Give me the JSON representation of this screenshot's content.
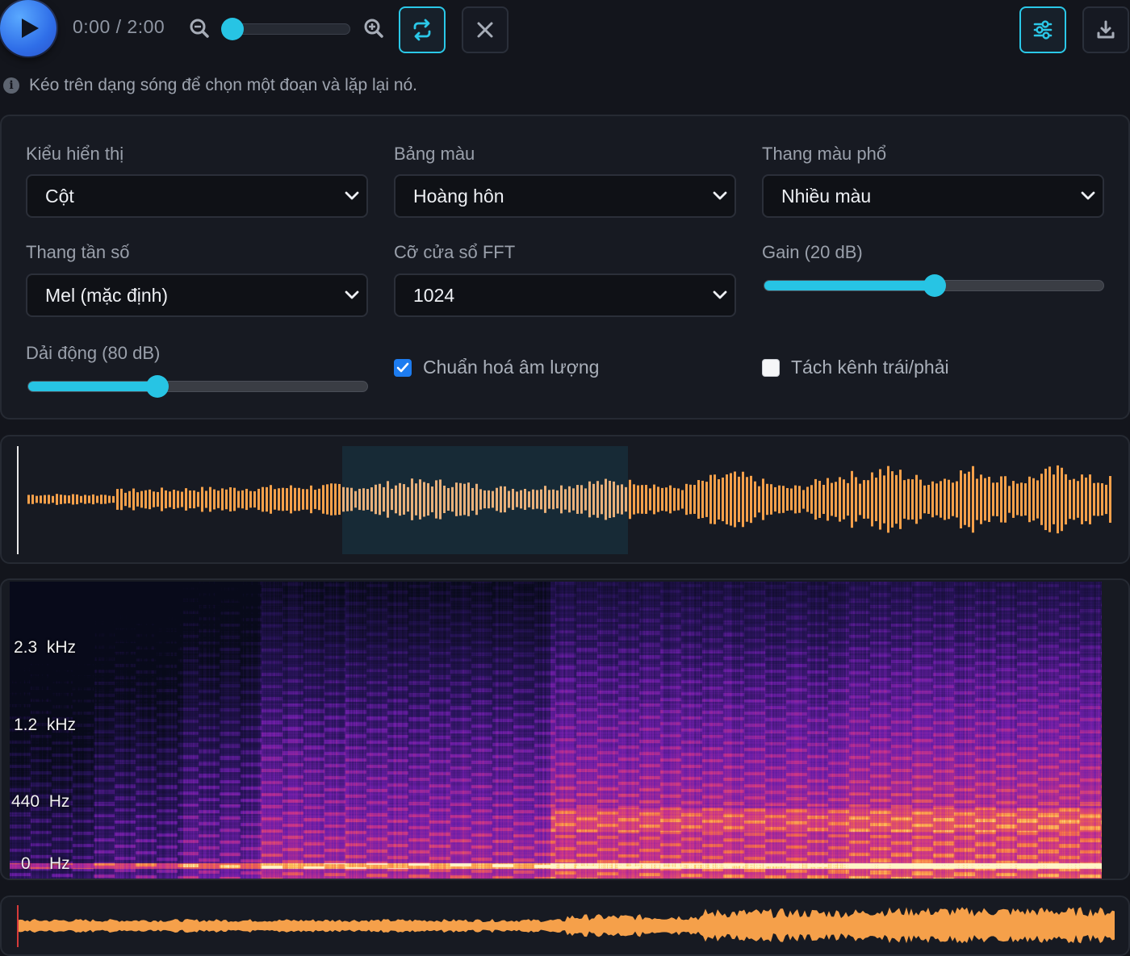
{
  "player": {
    "time_display": "0:00 / 2:00",
    "zoom_level": 0.02,
    "loop_active": true
  },
  "hint": {
    "text": "Kéo trên dạng sóng để chọn một đoạn và lặp lại nó."
  },
  "settings": {
    "display_mode": {
      "label": "Kiểu hiển thị",
      "value": "Cột"
    },
    "palette": {
      "label": "Bảng màu",
      "value": "Hoàng hôn"
    },
    "spectrum_scale": {
      "label": "Thang màu phổ",
      "value": "Nhiều màu"
    },
    "freq_scale": {
      "label": "Thang tần số",
      "value": "Mel (mặc định)"
    },
    "fft_size": {
      "label": "Cỡ cửa sổ FFT",
      "value": "1024"
    },
    "gain": {
      "label": "Gain (20 dB)",
      "level": 0.5
    },
    "dynamic_range": {
      "label": "Dải động (80 dB)",
      "level": 0.38
    },
    "normalize": {
      "label": "Chuẩn hoá âm lượng",
      "checked": true
    },
    "split_channels": {
      "label": "Tách kênh trái/phải",
      "checked": false
    }
  },
  "spectrogram": {
    "freq_labels": [
      "2.3  kHz",
      "1.2  kHz",
      "440  Hz",
      "0    Hz"
    ]
  },
  "colors": {
    "accent": "#27c4e4",
    "waveform": "#f5a04a",
    "checkbox": "#1d7cf0"
  }
}
